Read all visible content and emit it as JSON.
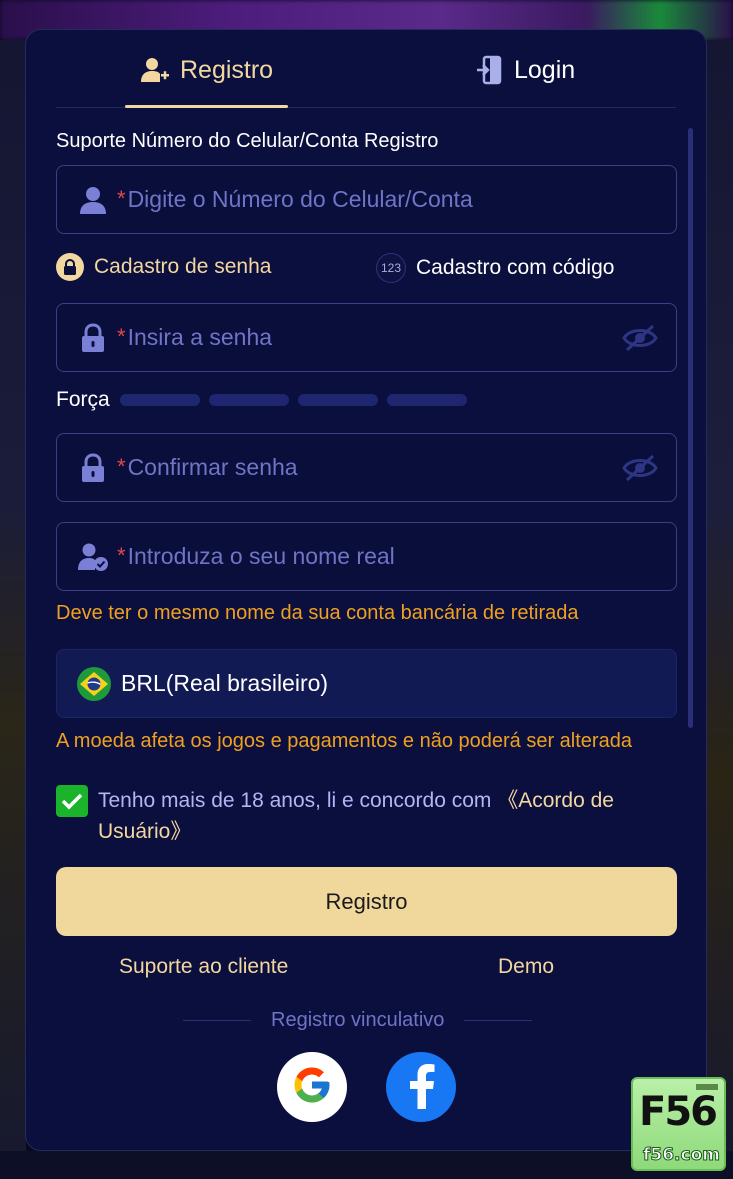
{
  "tabs": {
    "register": "Registro",
    "login": "Login"
  },
  "form": {
    "account_label": "Suporte Número do Celular/Conta Registro",
    "required_mark": "*",
    "account_placeholder": "Digite o Número do Celular/Conta",
    "mode_password": "Cadastro de senha",
    "mode_code": "Cadastro com código",
    "mode_code_icon_text": "123",
    "password_placeholder": "Insira a senha",
    "strength_label": "Força",
    "strength_level": 0,
    "confirm_placeholder": "Confirmar senha",
    "realname_placeholder": "Introduza o seu nome real",
    "realname_warning": "Deve ter o mesmo nome da sua conta bancária de retirada",
    "currency": "BRL(Real brasileiro)",
    "currency_warning": "A moeda afeta os jogos e pagamentos e não poderá ser alterada",
    "agree_checked": true,
    "agree_text": "Tenho mais de 18 anos, li e concordo com ",
    "agree_link": "《Acordo de Usuário》",
    "submit": "Registro"
  },
  "footer": {
    "support": "Suporte ao cliente",
    "demo": "Demo",
    "bind_title": "Registro vinculativo"
  },
  "social": [
    "google-icon",
    "facebook-icon"
  ],
  "watermark": {
    "logo": "F56",
    "domain": "f56.com"
  },
  "colors": {
    "accent": "#f2d7a0",
    "panel": "#0b0f3d",
    "warning": "#f0a020",
    "checkbox": "#1bb32c",
    "placeholder": "#6f74c6"
  }
}
